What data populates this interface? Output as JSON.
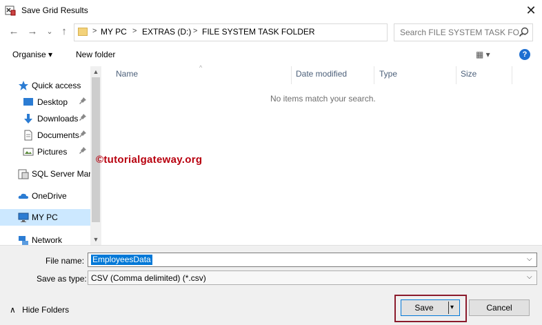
{
  "window": {
    "title": "Save Grid Results",
    "close_glyph": "✕"
  },
  "nav_buttons": {
    "back_glyph": "←",
    "forward_glyph": "→",
    "recent_glyph": "⌄",
    "up_glyph": "↑"
  },
  "address": {
    "crumbs": [
      "MY PC",
      "EXTRAS (D:)",
      "FILE SYSTEM TASK FOLDER"
    ],
    "separator": ">",
    "dropdown_glyph": "⌄",
    "refresh_glyph": "↻"
  },
  "search": {
    "placeholder": "Search FILE SYSTEM TASK FO..."
  },
  "toolbar": {
    "organise_label": "Organise ▾",
    "new_folder_label": "New folder",
    "views_glyph": "▦ ▾",
    "help_glyph": "?"
  },
  "sidebar": {
    "items": [
      {
        "label": "Quick access",
        "icon": "star-icon"
      },
      {
        "label": "Desktop",
        "icon": "desktop-icon",
        "pinned": true
      },
      {
        "label": "Downloads",
        "icon": "download-icon",
        "pinned": true
      },
      {
        "label": "Documents",
        "icon": "document-icon",
        "pinned": true
      },
      {
        "label": "Pictures",
        "icon": "pictures-icon",
        "pinned": true
      },
      {
        "label": "SQL Server Man",
        "icon": "sql-server-icon"
      },
      {
        "label": "OneDrive",
        "icon": "cloud-icon"
      },
      {
        "label": "MY PC",
        "icon": "computer-icon",
        "selected": true
      },
      {
        "label": "Network",
        "icon": "network-icon"
      }
    ],
    "pin_glyph": "📌",
    "scroll_up_glyph": "▲",
    "scroll_down_glyph": "▼"
  },
  "filelist": {
    "columns": [
      "Name",
      "Date modified",
      "Type",
      "Size"
    ],
    "sort_glyph": "^",
    "empty_message": "No items match your search.",
    "watermark": "©tutorialgateway.org"
  },
  "form": {
    "filename_label": "File name:",
    "filename_value": "EmployeesData",
    "savetype_label": "Save as type:",
    "savetype_value": "CSV (Comma delimited) (*.csv)",
    "dropdown_glyph": "⌵"
  },
  "footer": {
    "hide_folders_label": "Hide Folders",
    "hide_glyph": "∧",
    "save_label": "Save",
    "save_split_glyph": "▾",
    "cancel_label": "Cancel"
  },
  "colors": {
    "accent": "#0078d7",
    "selection": "#cce8ff",
    "highlight_box": "#8b1a2b",
    "watermark": "#b8000e"
  }
}
